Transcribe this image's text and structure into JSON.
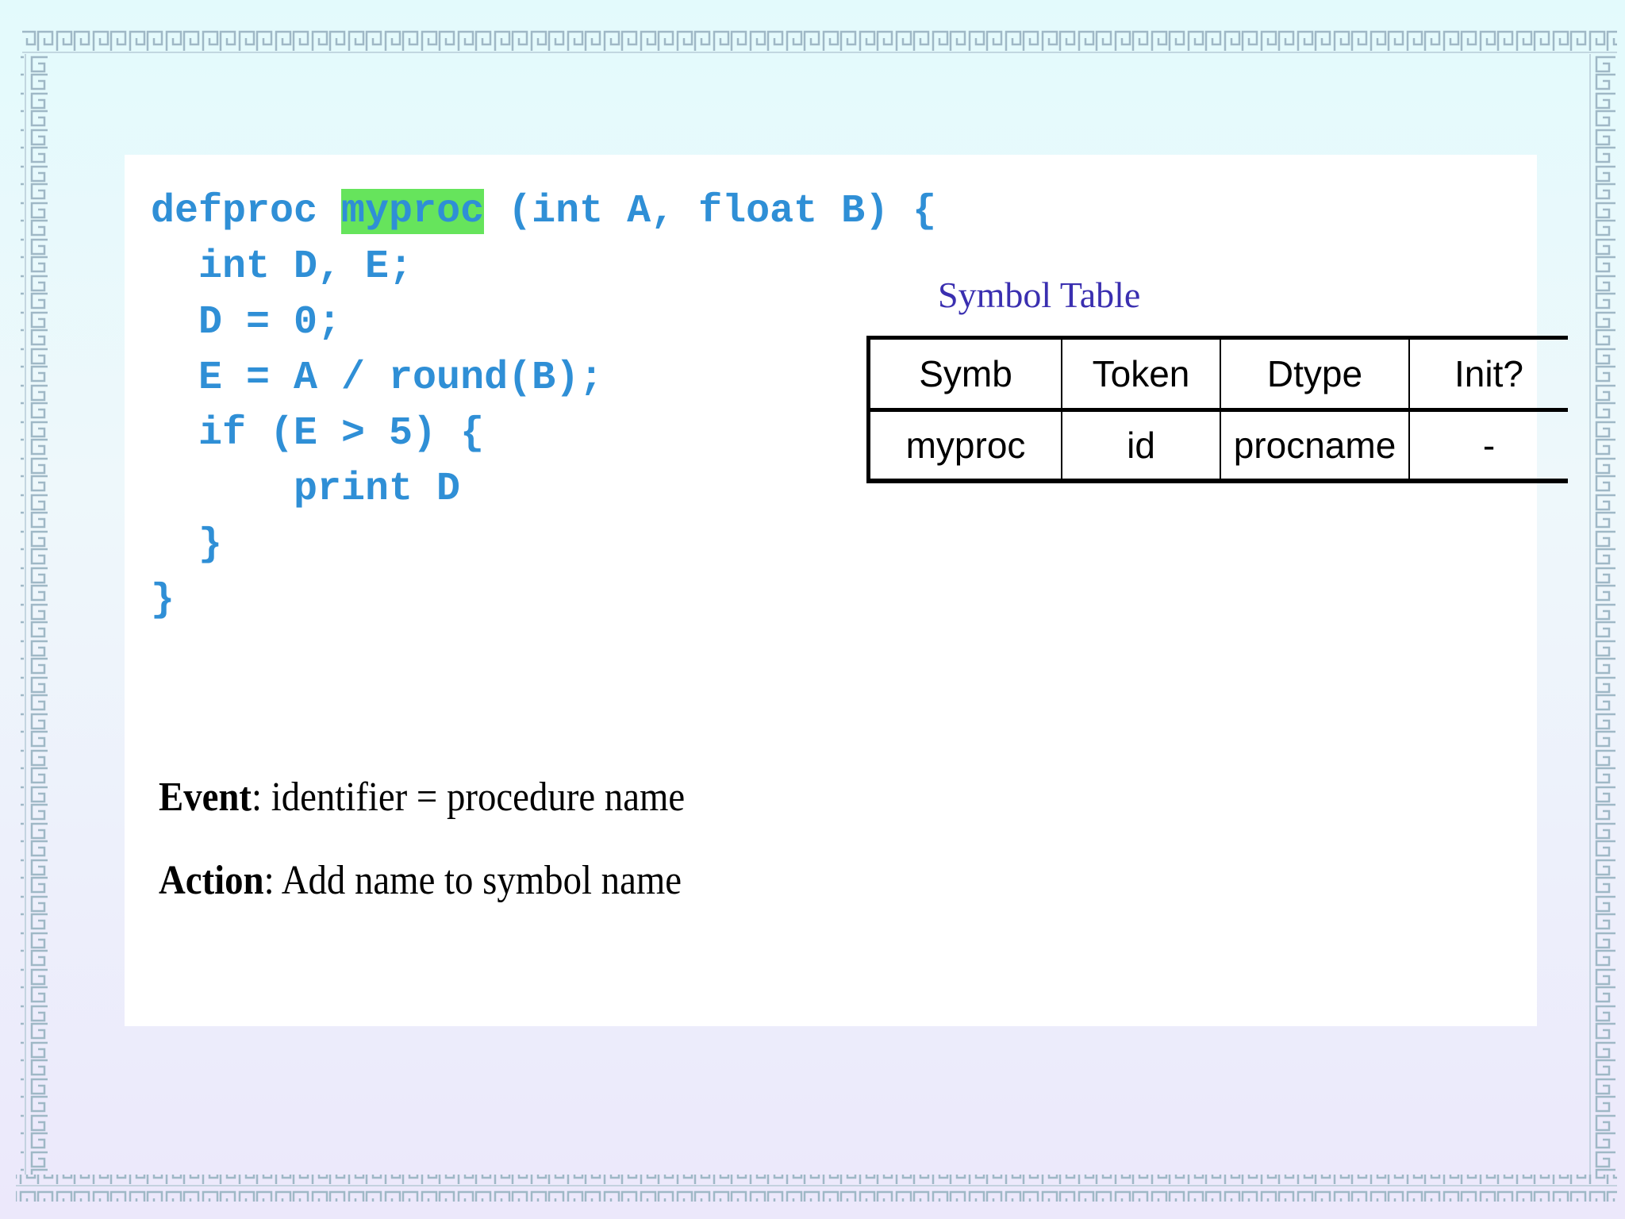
{
  "code": {
    "line1": {
      "before": "defproc ",
      "highlight": "myproc",
      "after": " (int A, float B) {"
    },
    "line2": "  int D, E;",
    "line3": "  D = 0;",
    "line4": "  E = A / round(B);",
    "line5": "  if (E > 5) {",
    "line6": "      print D",
    "line7": "  }",
    "line8": "}"
  },
  "symbol_table": {
    "title": "Symbol Table",
    "headers": {
      "symb": "Symb",
      "token": "Token",
      "dtype": "Dtype",
      "init": "Init?"
    },
    "row": {
      "symb": "myproc",
      "token": "id",
      "dtype": "procname",
      "init": "-"
    }
  },
  "event": {
    "label": "Event",
    "text": ": identifier = procedure name"
  },
  "action": {
    "label": "Action",
    "text": ": Add name to symbol name"
  },
  "colors": {
    "code": "#2f8fd6",
    "highlight": "#66e45c",
    "title": "#3a2fb0",
    "frame": "#9fb8c6"
  }
}
